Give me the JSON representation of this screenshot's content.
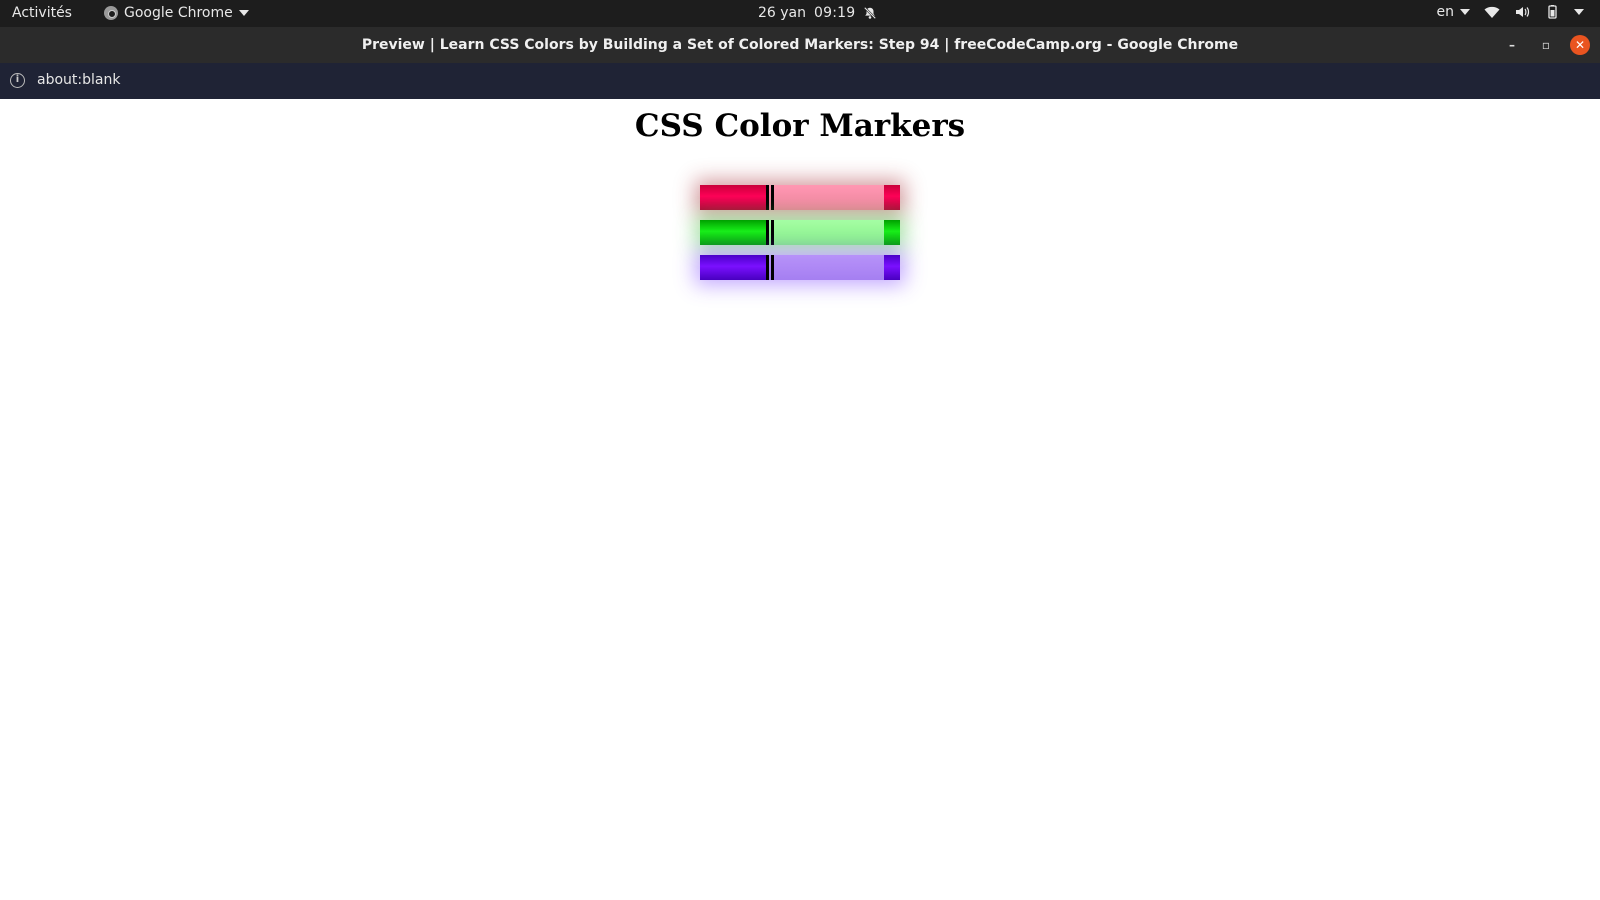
{
  "topbar": {
    "activities": "Activités",
    "app_name": "Google Chrome",
    "date": "26 yan",
    "time": "09:19",
    "lang": "en"
  },
  "window": {
    "title": "Preview | Learn CSS Colors by Building a Set of Colored Markers: Step 94 | freeCodeCamp.org - Google Chrome",
    "minimize_label": "–",
    "restore_label": "▫",
    "close_label": "✕"
  },
  "addressbar": {
    "url": "about:blank",
    "info_icon": "i"
  },
  "page": {
    "heading": "CSS Color Markers",
    "markers": [
      {
        "name": "red",
        "color": "#ff0058"
      },
      {
        "name": "green",
        "color": "#18f018"
      },
      {
        "name": "blue",
        "color": "#7a10ff"
      }
    ]
  },
  "icons": {
    "notification": "bell-muted-icon",
    "wifi": "wifi-icon",
    "volume": "volume-icon",
    "battery": "battery-icon",
    "system_menu": "chevron-down-icon"
  }
}
